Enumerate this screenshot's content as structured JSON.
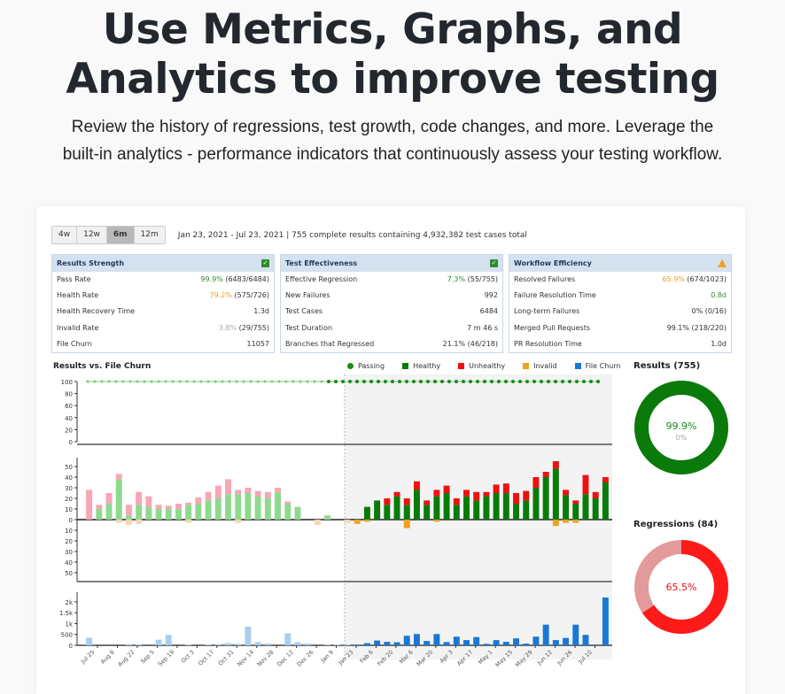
{
  "hero": {
    "title_line1": "Use Metrics, Graphs, and",
    "title_line2": "Analytics to improve testing",
    "subtitle_line1": "Review the history of regressions, test growth, code changes, and more. Leverage the",
    "subtitle_line2": "built-in analytics - performance indicators that continuously assess your testing workflow."
  },
  "range": {
    "options": [
      "4w",
      "12w",
      "6m",
      "12m"
    ],
    "selected": "6m",
    "summary": "Jan 23, 2021 - Jul 23, 2021 | 755 complete results containing 4,932,382 test cases total"
  },
  "cards": [
    {
      "title": "Results Strength",
      "status": "ok",
      "rows": [
        {
          "label": "Pass Rate",
          "pct": "99.9%",
          "pct_color": "g",
          "rest": " (6483/6484)"
        },
        {
          "label": "Health Rate",
          "pct": "79.2%",
          "pct_color": "o",
          "rest": " (575/726)"
        },
        {
          "label": "Health Recovery Time",
          "pct": "",
          "pct_color": "",
          "rest": "1.3d"
        },
        {
          "label": "Invalid Rate",
          "pct": "3.8%",
          "pct_color": "m",
          "rest": " (29/755)"
        },
        {
          "label": "File Churn",
          "pct": "",
          "pct_color": "",
          "rest": "11057"
        }
      ]
    },
    {
      "title": "Test Effectiveness",
      "status": "ok",
      "rows": [
        {
          "label": "Effective Regression",
          "pct": "7.3%",
          "pct_color": "g",
          "rest": " (55/755)"
        },
        {
          "label": "New Failures",
          "pct": "",
          "pct_color": "",
          "rest": "992"
        },
        {
          "label": "Test Cases",
          "pct": "",
          "pct_color": "",
          "rest": "6484"
        },
        {
          "label": "Test Duration",
          "pct": "",
          "pct_color": "",
          "rest": "7 m 46 s"
        },
        {
          "label": "Branches that Regressed",
          "pct": "",
          "pct_color": "",
          "rest": "21.1% (46/218)"
        }
      ]
    },
    {
      "title": "Workflow Efficiency",
      "status": "warn",
      "rows": [
        {
          "label": "Resolved Failures",
          "pct": "65.9%",
          "pct_color": "o",
          "rest": " (674/1023)"
        },
        {
          "label": "Failure Resolution Time",
          "pct": "0.8d",
          "pct_color": "g",
          "rest": ""
        },
        {
          "label": "Long-term Failures",
          "pct": "",
          "pct_color": "",
          "rest": "0% (0/16)"
        },
        {
          "label": "Merged Pull Requests",
          "pct": "",
          "pct_color": "",
          "rest": "99.1% (218/220)"
        },
        {
          "label": "PR Resolution Time",
          "pct": "",
          "pct_color": "",
          "rest": "1.0d"
        }
      ]
    }
  ],
  "chart": {
    "title": "Results vs. File Churn",
    "legend": [
      {
        "label": "Passing",
        "color": "#1a8a1a",
        "shape": "dot"
      },
      {
        "label": "Healthy",
        "color": "#0a7a0a",
        "shape": "square"
      },
      {
        "label": "Unhealthy",
        "color": "#ee1111",
        "shape": "square"
      },
      {
        "label": "Invalid",
        "color": "#f0a020",
        "shape": "square"
      },
      {
        "label": "File Churn",
        "color": "#1a78d4",
        "shape": "square"
      }
    ]
  },
  "donuts": {
    "results": {
      "title": "Results (755)",
      "main": "99.9%",
      "sub": "0%",
      "main_color": "#1a8a1a",
      "value": 0.999,
      "color": "#0a7a0a",
      "rest_color": "#c8c8c8"
    },
    "regressions": {
      "title": "Regressions (84)",
      "main": "65.5%",
      "main_color": "#ee1111",
      "value": 0.655,
      "color": "#ff1a1a",
      "rest_color": "#e39a9a"
    }
  },
  "chart_data": [
    {
      "type": "line",
      "name": "pass-rate",
      "ylim": [
        0,
        100
      ],
      "yticks": [
        0,
        20,
        40,
        60,
        80,
        100
      ],
      "series": [
        {
          "name": "Passing",
          "values": [
            100,
            100,
            100,
            100,
            100,
            100,
            100,
            100,
            100,
            100,
            100,
            100,
            100,
            100,
            100,
            100,
            100,
            100,
            100,
            100,
            100,
            100,
            100,
            100,
            100,
            100,
            100,
            100,
            100,
            100,
            100,
            100,
            100,
            100,
            100,
            100,
            100,
            100,
            100,
            100,
            100,
            100,
            100,
            100,
            100,
            100,
            100,
            100,
            100,
            100,
            100,
            100,
            100,
            100,
            100,
            100,
            100,
            100,
            100,
            100,
            100,
            100,
            100,
            100,
            100,
            100,
            100,
            100,
            100,
            100,
            100,
            100,
            100
          ]
        }
      ]
    },
    {
      "type": "bar",
      "name": "results",
      "ylim": [
        -50,
        50
      ],
      "yticks": [
        50,
        40,
        30,
        20,
        10,
        0,
        10,
        20,
        30,
        40,
        50
      ],
      "x": [
        "Jul 25",
        "Aug 8",
        "Aug 22",
        "Sep 5",
        "Sep 19",
        "Oct 3",
        "Oct 17",
        "Oct 31",
        "Nov 14",
        "Nov 28",
        "Dec 12",
        "Dec 26",
        "Jan 9",
        "Jan 23",
        "Feb 6",
        "Feb 20",
        "Mar 6",
        "Mar 20",
        "Apr 3",
        "Apr 17",
        "May 1",
        "May 15",
        "May 29",
        "Jun 12",
        "Jun 26",
        "Jul 10"
      ],
      "series": [
        {
          "name": "Healthy",
          "values": [
            0,
            10,
            15,
            38,
            4,
            14,
            12,
            10,
            10,
            10,
            14,
            15,
            18,
            20,
            24,
            24,
            25,
            22,
            20,
            26,
            15,
            12,
            0,
            0,
            4,
            0,
            0,
            0,
            12,
            18,
            14,
            22,
            14,
            28,
            14,
            22,
            25,
            14,
            22,
            18,
            22,
            25,
            25,
            15,
            18,
            30,
            40,
            48,
            23,
            15,
            24,
            20,
            35
          ]
        },
        {
          "name": "Unhealthy",
          "values": [
            0,
            0,
            0,
            0,
            0,
            0,
            0,
            0,
            0,
            0,
            0,
            0,
            0,
            0,
            0,
            0,
            0,
            0,
            0,
            0,
            0,
            0,
            0,
            0,
            0,
            0,
            0,
            0,
            0,
            0,
            6,
            4,
            6,
            8,
            4,
            6,
            7,
            6,
            6,
            8,
            4,
            8,
            9,
            10,
            9,
            10,
            5,
            7,
            5,
            3,
            18,
            6,
            5
          ]
        },
        {
          "name": "Unhealthy (history)",
          "values": [
            28,
            4,
            10,
            5,
            10,
            12,
            10,
            4,
            3,
            5,
            2,
            6,
            8,
            12,
            14,
            4,
            5,
            5,
            6,
            4,
            2,
            0,
            0,
            0,
            0,
            0,
            0,
            0,
            0,
            0,
            0,
            0,
            0,
            0,
            0,
            0,
            0,
            0,
            0,
            0,
            0,
            0,
            0,
            0,
            0,
            0,
            0,
            0,
            0,
            0,
            0,
            0,
            0
          ]
        },
        {
          "name": "Invalid",
          "values": [
            0,
            0,
            0,
            3,
            5,
            4,
            0,
            0,
            0,
            0,
            3,
            0,
            0,
            0,
            0,
            3,
            0,
            0,
            0,
            0,
            0,
            0,
            0,
            5,
            0,
            0,
            3,
            4,
            2,
            0,
            0,
            0,
            8,
            0,
            0,
            2,
            0,
            0,
            0,
            0,
            0,
            0,
            0,
            0,
            0,
            0,
            0,
            6,
            3,
            3,
            0,
            0,
            0
          ]
        }
      ]
    },
    {
      "type": "bar",
      "name": "file-churn",
      "ylim": [
        0,
        2200
      ],
      "yticks": [
        "0",
        "500",
        "1k",
        "1.5k",
        "2k"
      ],
      "series": [
        {
          "name": "File Churn",
          "values": [
            350,
            0,
            0,
            0,
            60,
            20,
            0,
            260,
            480,
            0,
            30,
            0,
            40,
            50,
            100,
            70,
            860,
            150,
            80,
            0,
            550,
            140,
            80,
            0,
            20,
            30,
            40,
            30,
            100,
            220,
            160,
            140,
            440,
            520,
            200,
            520,
            150,
            400,
            240,
            380,
            70,
            240,
            160,
            320,
            80,
            400,
            950,
            240,
            340,
            950,
            480,
            0,
            2200
          ]
        }
      ]
    }
  ]
}
